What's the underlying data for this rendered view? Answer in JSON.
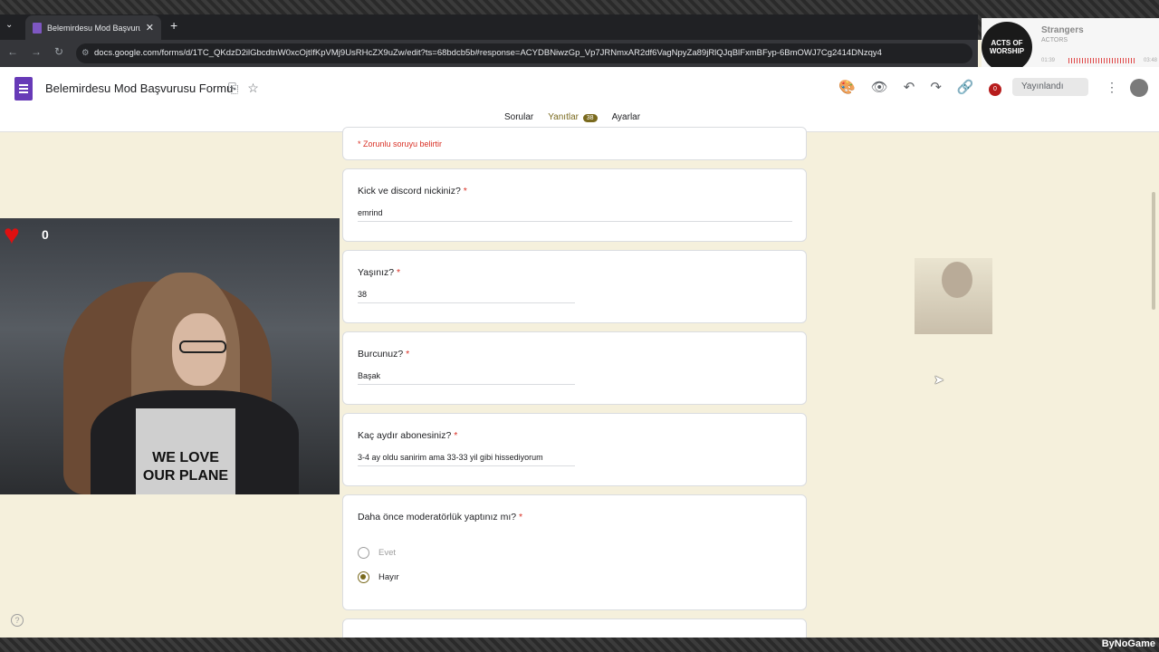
{
  "browser": {
    "tab_title": "Belemirdesu Mod Başvurusu Fo",
    "tab_close": "✕",
    "new_tab": "+",
    "url": "docs.google.com/forms/d/1TC_QKdzD2ilGbcdtnW0xcOjtIfKpVMj9UsRHcZX9uZw/edit?ts=68bdcb5b#response=ACYDBNiwzGp_Vp7JRNmxAR2df6VagNpyZa89jRlQJqBlFxmBFyp-6BmOWJ7Cg2414DNzqy4"
  },
  "music": {
    "cover_text": "ACTS OF WORSHIP",
    "song": "Strangers",
    "artist": "ACTORS",
    "time_elapsed": "01:39",
    "time_total": "03:48"
  },
  "header": {
    "form_title": "Belemirdesu Mod Başvurusu Formu",
    "notif_count": "0",
    "publish_label": "Yayınlandı",
    "tabs": {
      "questions": "Sorular",
      "responses": "Yanıtlar",
      "responses_count": "38",
      "settings": "Ayarlar"
    }
  },
  "form": {
    "required_note": "* Zorunlu soruyu belirtir",
    "questions": [
      {
        "label": "Kick ve discord nickiniz?",
        "required": "*",
        "answer": "emrind"
      },
      {
        "label": "Yaşınız?",
        "required": "*",
        "answer": "38"
      },
      {
        "label": "Burcunuz?",
        "required": "*",
        "answer": "Başak"
      },
      {
        "label": "Kaç aydır abonesiniz?",
        "required": "*",
        "answer": "3-4 ay oldu sanirim ama 33-33 yil gibi hissediyorum"
      },
      {
        "label": "Daha önce moderatörlük yaptınız mı?",
        "required": "*",
        "options": [
          "Evet",
          "Hayır"
        ],
        "selected": "Hayır"
      }
    ]
  },
  "webcam": {
    "heart_count": "0",
    "shirt_text": "WE LOVE OUR PLANE"
  },
  "footer": {
    "help": "?",
    "watermark": "ByNoGame"
  }
}
